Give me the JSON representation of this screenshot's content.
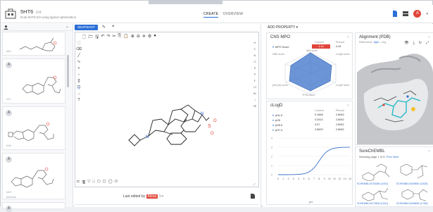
{
  "header": {
    "project_title": "5HT6",
    "version": "104",
    "subtitle": "Dual 5HT6-D3 using ligand optimization",
    "tabs": [
      {
        "label": "CREATE",
        "active": true
      },
      {
        "label": "OVERVIEW",
        "active": false
      }
    ],
    "avatar_initial": "A"
  },
  "compound_list": {
    "items": [
      {
        "badge": "",
        "id": "#80",
        "tag": ""
      },
      {
        "badge": "A",
        "id": "#47",
        "tag": ""
      },
      {
        "badge": "A",
        "id": "#48",
        "tag": ""
      },
      {
        "badge": "A",
        "id": "#49",
        "tag": "Medium"
      },
      {
        "badge": "A",
        "id": "",
        "tag": ""
      }
    ]
  },
  "editor": {
    "snapshot_label": "SNAPSHOT",
    "last_edited_prefix": "Last edited by",
    "last_edited_user": "Alexa",
    "last_edited_time": "1m"
  },
  "right": {
    "add_property_label": "ADD PROPERTY",
    "cns_mpo": {
      "title": "CNS MPO",
      "col_current": "Current",
      "col_pinned": "Pinned",
      "rows": [
        {
          "label": "MPO Score",
          "current": "4.44",
          "pinned": "4.44"
        }
      ],
      "radar_labels": [
        "MW score",
        "cLogD score",
        "HBD score",
        "TPSA score",
        "pKa (bf) score",
        "cLogP score"
      ]
    },
    "clogd": {
      "title": "cLogD",
      "col_current": "Current",
      "col_pinned": "Pinned",
      "rows": [
        {
          "label": "pH1.5",
          "current": "0.1666",
          "pinned": "2.8062"
        },
        {
          "label": "pH5",
          "current": "0.2613",
          "pinned": "2.8062"
        },
        {
          "label": "pH5.5",
          "current": "3.97",
          "pinned": "2.8062"
        },
        {
          "label": "pH7.4",
          "current": "2.8003",
          "pinned": "2.8062"
        }
      ],
      "x_axis_label": "pH",
      "x_ticks": [
        "0",
        "1",
        "2",
        "3",
        "4",
        "5",
        "6",
        "7",
        "8",
        "9",
        "10",
        "11",
        "12",
        "13",
        "14"
      ],
      "y_ticks": [
        "4",
        "3",
        "2",
        "1",
        "0"
      ]
    },
    "alignment": {
      "title": "Alignment (PDB)",
      "reference_prefix": "Reference:",
      "reference_link": "5ght",
      "reference_suffix": "- org."
    },
    "surechembl": {
      "title": "SureChEMBL",
      "subtitle_prefix": "Showing page 1 of 5.",
      "subtitle_link": "Prev Next",
      "ids": [
        "SCHEMBL15700284 (0.811)",
        "SCHEMBL15409551 (0.825)",
        "SCHEMBL15170604 (0.811)",
        "SCHEMBL15436654 (0.785)"
      ]
    }
  },
  "colors": {
    "accent": "#2c6fd6",
    "alert": "#e0453a"
  },
  "icons": [
    "logo-icon",
    "user-icon",
    "minus-icon",
    "pin-icon",
    "crosshair-icon",
    "document-icon",
    "grid-icon",
    "eye-icon",
    "download-icon",
    "refresh-icon",
    "expand-icon"
  ]
}
